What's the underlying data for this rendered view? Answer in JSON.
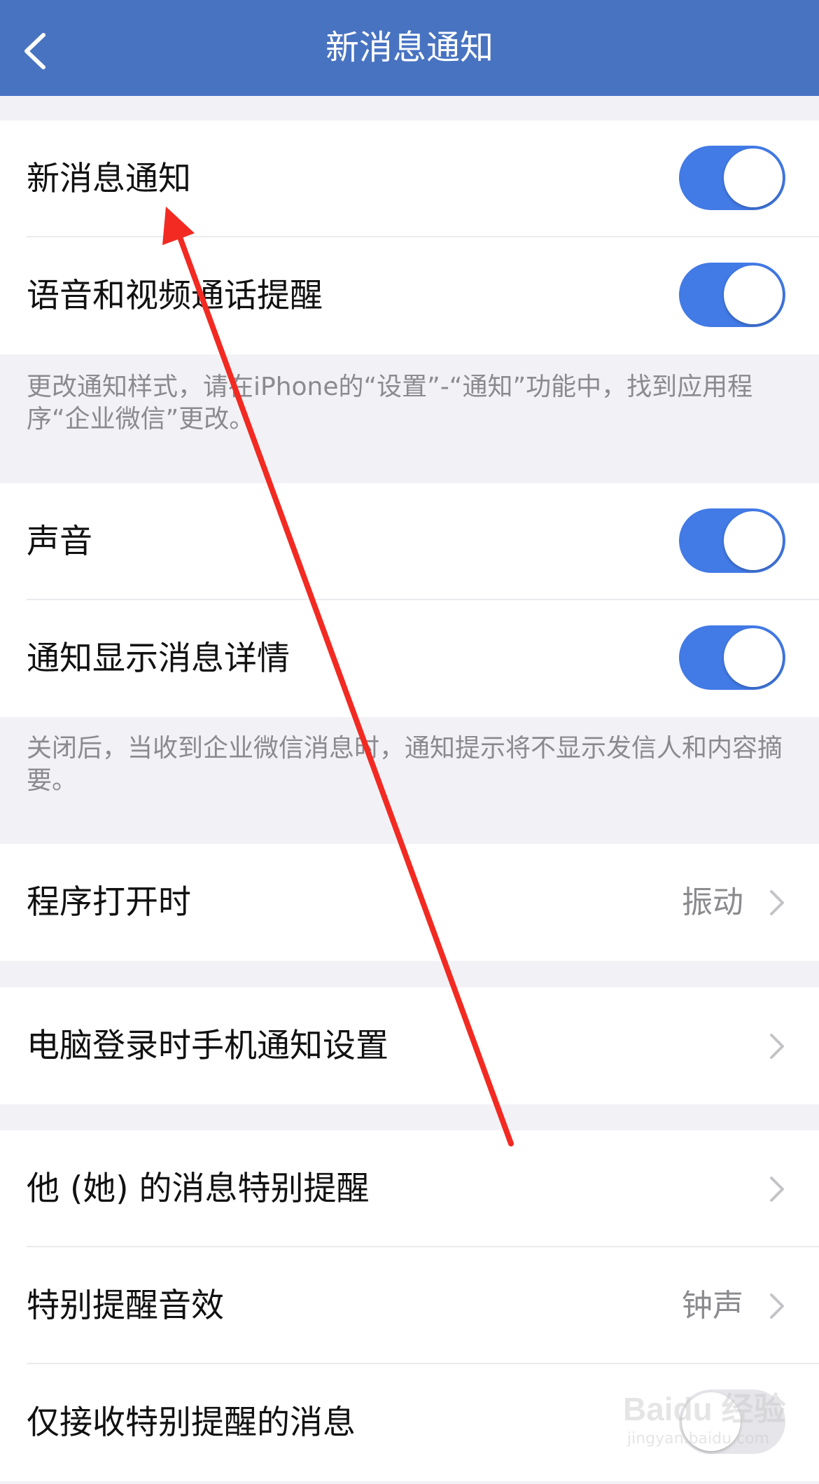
{
  "nav": {
    "title": "新消息通知",
    "back_icon": "chevron-left-icon"
  },
  "settings": [
    {
      "label": "新消息通知",
      "control": "toggle",
      "on": true
    },
    {
      "label": "语音和视频通话提醒",
      "control": "toggle",
      "on": true
    },
    {
      "label": "声音",
      "control": "toggle",
      "on": true
    },
    {
      "label": "通知显示消息详情",
      "control": "toggle",
      "on": true
    },
    {
      "label": "程序打开时",
      "control": "disclosure",
      "value": "振动"
    },
    {
      "label": "电脑登录时手机通知设置",
      "control": "disclosure"
    },
    {
      "label": "他 (她) 的消息特别提醒",
      "control": "disclosure"
    },
    {
      "label": "特别提醒音效",
      "control": "disclosure",
      "value": "钟声"
    },
    {
      "label": "仅接收特别提醒的消息",
      "control": "toggle",
      "on": false
    }
  ],
  "hints": {
    "style_hint": "更改通知样式，请在iPhone的“设置”-“通知”功能中，找到应用程序“企业微信”更改。",
    "detail_hint": "关闭后，当收到企业微信消息时，通知提示将不显示发信人和内容摘要。"
  },
  "watermark": {
    "main": "Baidu 经验",
    "sub": "jingyan.baidu.com"
  },
  "colors": {
    "nav_bar": "#4873c1",
    "toggle_on": "#427ae6",
    "annotation_arrow": "#f22a22"
  }
}
